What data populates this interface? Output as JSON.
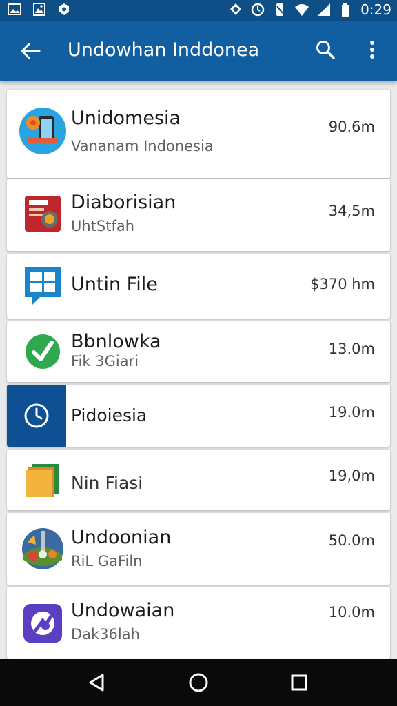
{
  "status_bar": {
    "time": "0:29",
    "left_icons": [
      "image-icon",
      "gallery-icon",
      "notification-icon"
    ],
    "right_icons": [
      "sync-icon",
      "alarm-icon",
      "vibrate-icon",
      "wifi-icon",
      "signal-icon",
      "battery-icon"
    ]
  },
  "app_bar": {
    "title": "Undowhan Inddonea",
    "background": "#115ea1",
    "status_background": "#0d4f86"
  },
  "apps": [
    {
      "name": "Unidomesia",
      "subtitle": "Vananam Indonesia",
      "size": "90.6m",
      "icon": "phone-browser-icon"
    },
    {
      "name": "Diaborisian",
      "subtitle": "UhtStfah",
      "size": "34,5m",
      "icon": "red-book-icon"
    },
    {
      "name": "Untin File",
      "subtitle": "",
      "size": "$370 hm",
      "icon": "file-window-icon"
    },
    {
      "name": "Bbnlowka",
      "subtitle": "Fik 3Giari",
      "size": "13.0m",
      "icon": "green-check-icon"
    },
    {
      "name": "Pidoiesia",
      "subtitle": "",
      "size": "19.0m",
      "icon": "clock-icon"
    },
    {
      "name": "Nin Fiasi",
      "subtitle": "",
      "size": "19,0m",
      "icon": "folder-icon"
    },
    {
      "name": "Undoonian",
      "subtitle": "RiL GaFiln",
      "size": "50.0m",
      "icon": "garden-icon"
    },
    {
      "name": "Undowaian",
      "subtitle": "Dak36lah",
      "size": "10.0m",
      "icon": "purple-app-icon"
    }
  ]
}
